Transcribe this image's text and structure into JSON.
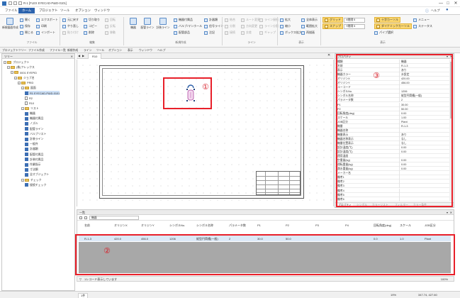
{
  "app": {
    "title": "R-1 [FLEX EYECAD-P&ID-0101]",
    "window_controls": [
      "—",
      "□",
      "✕"
    ]
  },
  "menu": {
    "items": [
      "ファイル",
      "ホーム",
      "プロジェクト",
      "ツール",
      "オプション",
      "ウィンドウ"
    ],
    "active": "ホーム",
    "help": "ヘルプ"
  },
  "ribbon": {
    "groups": [
      "ファイル",
      "編集",
      "新規作成",
      "ライン",
      "表示",
      "表示"
    ],
    "new_drawing": "新規図面作成",
    "file": [
      "開く",
      "保存",
      "閉じる"
    ],
    "export": [
      "エクスポート",
      "印刷",
      "インポート"
    ],
    "edit": [
      "元に戻す",
      "やり直し",
      "貼り付け",
      "切り取り",
      "コピー",
      "削除",
      "回転",
      "反転",
      "移動"
    ],
    "create": [
      "機器",
      "配管ライン",
      "計装ライン",
      "機器付属品",
      "バルブ/マンホール",
      "配管部品",
      "計器類",
      "信号ライン",
      "注記"
    ],
    "line": [
      "結合",
      "分割",
      "接続",
      "ルート変更",
      "方向変更",
      "交差",
      "ライン接続",
      "ライン分割",
      "ギャップ"
    ],
    "view": [
      "拡大",
      "縮小",
      "全体表示",
      "範囲拡大",
      "ボックス拡大",
      "再描画"
    ],
    "snap": [
      "グリッド",
      "スナップ"
    ],
    "spin_x": "X間隔 5",
    "spin_y": "Y間隔 5",
    "cross": "十字カーソル",
    "dynamic": "ダイナミックカーソル",
    "pipe_select": "パイプ選択",
    "right": [
      "メニュー",
      "ステータス"
    ]
  },
  "toolbar": {
    "items": [
      "プロジェクトツリー",
      "ファイル作成",
      "ファイル一覧",
      "新規作成",
      "ライン",
      "ツール",
      "オプション",
      "表示",
      "ウィンドウ",
      "ヘルプ"
    ]
  },
  "tree": {
    "header": "ツリー",
    "nodes": [
      {
        "label": "プロジェクト",
        "type": "folder",
        "level": 0,
        "toggle": "−"
      },
      {
        "label": "(株)フレックス",
        "type": "folder",
        "level": 1,
        "toggle": "−"
      },
      {
        "label": "0001 EYEPID",
        "type": "folder",
        "level": 2,
        "toggle": "−"
      },
      {
        "label": "ジョブ名",
        "type": "folder",
        "level": 3,
        "toggle": "−"
      },
      {
        "label": "PRID",
        "type": "folder",
        "level": 4,
        "toggle": "−"
      },
      {
        "label": "図面",
        "type": "folder",
        "level": 5,
        "toggle": "−"
      },
      {
        "label": "R1 EYECAD-P&ID-0101",
        "type": "doc",
        "level": 6,
        "toggle": "",
        "selected": true
      },
      {
        "label": "R2",
        "type": "page",
        "level": 6,
        "toggle": ""
      },
      {
        "label": "R10",
        "type": "page",
        "level": 6,
        "toggle": ""
      },
      {
        "label": "リスト",
        "type": "folder",
        "level": 5,
        "toggle": "−"
      },
      {
        "label": "機器",
        "type": "doc",
        "level": 6,
        "toggle": ""
      },
      {
        "label": "機器付属品",
        "type": "doc",
        "level": 6,
        "toggle": ""
      },
      {
        "label": "ノズル",
        "type": "doc",
        "level": 6,
        "toggle": ""
      },
      {
        "label": "配管ライン",
        "type": "doc",
        "level": 6,
        "toggle": ""
      },
      {
        "label": "バルブリスト",
        "type": "doc",
        "level": 6,
        "toggle": ""
      },
      {
        "label": "計装ライン",
        "type": "doc",
        "level": 6,
        "toggle": ""
      },
      {
        "label": "一般弁",
        "type": "doc",
        "level": 6,
        "toggle": ""
      },
      {
        "label": "計器類",
        "type": "doc",
        "level": 6,
        "toggle": ""
      },
      {
        "label": "配管付属品",
        "type": "doc",
        "level": 6,
        "toggle": ""
      },
      {
        "label": "計装付属品",
        "type": "doc",
        "level": 6,
        "toggle": ""
      },
      {
        "label": "作業指示",
        "type": "doc",
        "level": 6,
        "toggle": ""
      },
      {
        "label": "寸法類",
        "type": "doc",
        "level": 6,
        "toggle": ""
      },
      {
        "label": "全オブジェクト",
        "type": "doc",
        "level": 6,
        "toggle": ""
      },
      {
        "label": "チェック",
        "type": "folder",
        "level": 5,
        "toggle": "−"
      },
      {
        "label": "接続チェック",
        "type": "doc",
        "level": 6,
        "toggle": ""
      }
    ]
  },
  "canvas": {
    "tab": "R10",
    "callout_1": "①",
    "callout_2": "②",
    "callout_3": "③"
  },
  "list": {
    "header": "一覧",
    "filter": "機器",
    "columns": [
      "名前",
      "オリジンX",
      "オリジンY",
      "シンボルNo.",
      "シンボル名称",
      "パラメータ数",
      "P1",
      "P2",
      "P3",
      "P4",
      "回転角度(deg)",
      "スケール",
      "JOB区分"
    ],
    "row": [
      "R-1-3",
      "420.0",
      "456.0",
      "1206",
      "縦型円筒槽(一般)",
      "2",
      "30.0",
      "50.0",
      "",
      "",
      "0.0",
      "1.0",
      "Plant"
    ],
    "status": "1レコード表示しています",
    "zoom": "100%"
  },
  "properties": {
    "header": "プロパティ",
    "rows": [
      [
        "種類",
        "機器"
      ],
      [
        "名前",
        "R-1-3"
      ],
      [
        "表示",
        "あり"
      ],
      [
        "機器カラー",
        "水設定"
      ],
      [
        "オリジンX",
        "420.00"
      ],
      [
        "オリジンY",
        "456.00"
      ],
      [
        "ユーコード",
        ""
      ],
      [
        "シンボルNo.",
        "1206"
      ],
      [
        "シンボル名称",
        "縦型円筒槽(一般)"
      ],
      [
        "パラメータ数",
        "2"
      ],
      [
        "P1",
        "30.00"
      ],
      [
        "P2",
        "50.00"
      ],
      [
        "回転角度(deg)",
        "0.00"
      ],
      [
        "スケール",
        "1.00"
      ],
      [
        "JOB区分",
        "Plant"
      ],
      [
        "機番",
        "R-1-3"
      ],
      [
        "機器名称",
        ""
      ],
      [
        "機番表示",
        "あり"
      ],
      [
        "機器名称表示",
        "なし"
      ],
      [
        "機番位置表示",
        "なし"
      ],
      [
        "設計温度(℃)",
        "0.00"
      ],
      [
        "設計温度(℃)",
        "0.00"
      ],
      [
        "運用温度",
        ""
      ],
      [
        "空重量(kg)",
        "0.00"
      ],
      [
        "運転重量(kg)",
        "0.00"
      ],
      [
        "満水重量(kg)",
        "0.00"
      ],
      [
        "メーカー名",
        ""
      ],
      [
        "備考1",
        ""
      ],
      [
        "備考2",
        ""
      ],
      [
        "備考3",
        ""
      ],
      [
        "備考4",
        ""
      ],
      [
        "備考5",
        ""
      ],
      [
        "備考6",
        ""
      ]
    ],
    "tabs": [
      "プロパティ",
      "シンボル",
      "カラーリスト",
      "フィルター",
      "カラー条件"
    ]
  },
  "statusbar": {
    "layers": "1件",
    "coords": "347.74, 427.60",
    "zoom": "19%"
  }
}
